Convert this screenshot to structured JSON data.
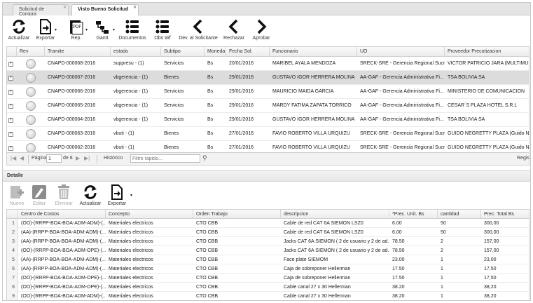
{
  "tabs": [
    {
      "label": "Solicitud de Compra",
      "active": false
    },
    {
      "label": "Visto Bueno Solicitud",
      "active": true
    }
  ],
  "toolbar": {
    "actualizar": "Actualizar",
    "exportar": "Exportar",
    "rep": "Rep.",
    "gantt": "Gantt",
    "documentos": "Documentos",
    "obs_wf": "Obs Wf",
    "dev_solicitante": "Dev. al Solicitante",
    "rechazar": "Rechazar",
    "aprobar": "Aprobar"
  },
  "main_grid": {
    "columns": [
      "Rev",
      "Tramite",
      "estado",
      "Subtipo",
      "Moneda",
      "Fecha Sol.",
      "Funcionario",
      "UO",
      "Proveedor Precotizacion"
    ],
    "rows": [
      {
        "tramite": "CNAPD-000068-2016",
        "estado": "suppresu - (1)",
        "subtipo": "Servicios",
        "moneda": "Bs",
        "fecha": "20/01/2016",
        "funcionario": "MARIBEL AYALA MENDOZA",
        "uo": "SRECK-SRE - Gerencia Regional Sucre",
        "proveedor": "VICTOR PATRICIO JARA (MULTIMUEB...",
        "selected": false
      },
      {
        "tramite": "CNAPD-000067-2016",
        "estado": "vbgerencia - (1)",
        "subtipo": "Bienes",
        "moneda": "Bs",
        "fecha": "29/01/2016",
        "funcionario": "GUSTAVO IGOR HERRERA MOLINA",
        "uo": "AA-GAF - Gerencia Administrativa Fi...",
        "proveedor": "TSA BOLIVIA SA",
        "selected": true
      },
      {
        "tramite": "CNAPD-000066-2016",
        "estado": "vbgerencia - (1)",
        "subtipo": "Servicios",
        "moneda": "Bs",
        "fecha": "29/01/2016",
        "funcionario": "MAURICIO MAIDA GARCIA",
        "uo": "AA-GAF - Gerencia Administrativa Fi...",
        "proveedor": "MINISTERIO DE COMUNICACION",
        "selected": false
      },
      {
        "tramite": "CNAPD-000065-2016",
        "estado": "vbgerencia - (1)",
        "subtipo": "Servicios",
        "moneda": "Bs",
        "fecha": "29/01/2016",
        "funcionario": "MARDY FATIMA ZAPATA TORRICO",
        "uo": "AA-GAF - Gerencia Administrativa Fi...",
        "proveedor": "CESAR´S PLAZA HOTEL S.R.L",
        "selected": false
      },
      {
        "tramite": "CNAPD-000064-2016",
        "estado": "vbgerencia - (1)",
        "subtipo": "Servicios",
        "moneda": "Bs",
        "fecha": "29/01/2016",
        "funcionario": "GUSTAVO IGOR HERRERA MOLINA",
        "uo": "AA-GAF - Gerencia Administrativa Fi...",
        "proveedor": "TSA BOLIVIA SA",
        "selected": false
      },
      {
        "tramite": "CNAPD-000063-2016",
        "estado": "vbuti - (1)",
        "subtipo": "Bienes",
        "moneda": "Bs",
        "fecha": "27/01/2016",
        "funcionario": "FAVIO ROBERTO VILLA URQUIZU",
        "uo": "SRECK-SRE - Gerencia Regional Sucre",
        "proveedor": "GUIDO NEGRETTY PLAZA (Guido Ne...",
        "selected": false
      },
      {
        "tramite": "CNAPD-000062-2016",
        "estado": "vbuti - (1)",
        "subtipo": "Bienes",
        "moneda": "Bs",
        "fecha": "27/01/2016",
        "funcionario": "FAVIO ROBERTO VILLA URQUIZU",
        "uo": "SRECK-SRE - Gerencia Regional Sucre",
        "proveedor": "GUIDO NEGRETTY PLAZA (Guido Ne...",
        "selected": false
      }
    ]
  },
  "pager": {
    "pagina_label": "Página",
    "page": "1",
    "of_label": "de 8",
    "historico": "Histórico",
    "filter_placeholder": "Filtro rápido...",
    "regis": "Regis"
  },
  "detail": {
    "title": "Detalle",
    "toolbar": {
      "nuevo": "Nuevo",
      "editar": "Editar",
      "eliminar": "Eliminar",
      "actualizar": "Actualizar",
      "exportar": "Exportar"
    },
    "columns": [
      "Centro de Costos",
      "Concepto",
      "Orden Trabajo",
      "descripcion",
      "*Prec. Unit. Bs",
      "cantidad",
      "Prec. Total Bs"
    ],
    "rows": [
      {
        "n": "1",
        "centro": "(OO)-(RRPP-BOA-BOA-ADM-ADM)-(...",
        "concepto": "Materiales electricos",
        "orden": "CTO CBB",
        "descripcion": "Cable de red CAT 6A SIEMON LSZ0",
        "unit": "6.00",
        "cantidad": "50",
        "total": "300,00"
      },
      {
        "n": "2",
        "centro": "(AA)-(RRPP-BOA-BOA-ADM-ADM)-(...",
        "concepto": "Materiales electricos",
        "orden": "CTO CBB",
        "descripcion": "Cable de red CAT 6A SIEMON LSZ0",
        "unit": "6.00",
        "cantidad": "50",
        "total": "300,00"
      },
      {
        "n": "3",
        "centro": "(AA)-(RRPP-BOA-BOA-ADM-ADM)-(...",
        "concepto": "Materiales electricos",
        "orden": "CTO CBB",
        "descripcion": "Jacks CAT 6A SIEMON ( 2 de usuario y 2 de ad...",
        "unit": "78.50",
        "cantidad": "2",
        "total": "157,00"
      },
      {
        "n": "4",
        "centro": "(OO)-(RRPP-BOA-BOA-ADM-OPE)-(...",
        "concepto": "Materiales electricos",
        "orden": "CTO CBB",
        "descripcion": "Jacks CAT 6A SIEMON ( 2 de usuario y 2 de ad...",
        "unit": "78.50",
        "cantidad": "2",
        "total": "157,00"
      },
      {
        "n": "5",
        "centro": "(AA)-(RRPP-BOA-BOA-ADM-ADM)-(...",
        "concepto": "Materiales electricos",
        "orden": "CTO CBB",
        "descripcion": "Face plate SIEMOM",
        "unit": "23.00",
        "cantidad": "1",
        "total": "23,00"
      },
      {
        "n": "6",
        "centro": "(AA)-(RRPP-BOA-BOA-ADM-ADM)-(...",
        "concepto": "Materiales electricos",
        "orden": "CTO CBB",
        "descripcion": "Caja de sobreponer Hellerman",
        "unit": "17.50",
        "cantidad": "1",
        "total": "17,50"
      },
      {
        "n": "7",
        "centro": "(OO)-(RRPP-BOA-BOA-ADM-OPE)-(...",
        "concepto": "Materiales electricos",
        "orden": "CTO CBB",
        "descripcion": "Caja de sobreponer Hellerman",
        "unit": "17.50",
        "cantidad": "1",
        "total": "17,50"
      },
      {
        "n": "8",
        "centro": "(OO)-(RRPP-BOA-BOA-ADM-OPE)-(...",
        "concepto": "Materiales electricos",
        "orden": "CTO CBB",
        "descripcion": "Cable canal 27 x 30 Hellerman",
        "unit": "38.20",
        "cantidad": "1",
        "total": "38,20"
      },
      {
        "n": "9",
        "centro": "(OO)-(RRPP-BOA-BOA-ADM-ADM)-(...",
        "concepto": "Materiales electricos",
        "orden": "CTO CBB",
        "descripcion": "Cable canal 27 x 30 Hellerman",
        "unit": "38.20",
        "cantidad": "1",
        "total": "38,20"
      }
    ]
  }
}
